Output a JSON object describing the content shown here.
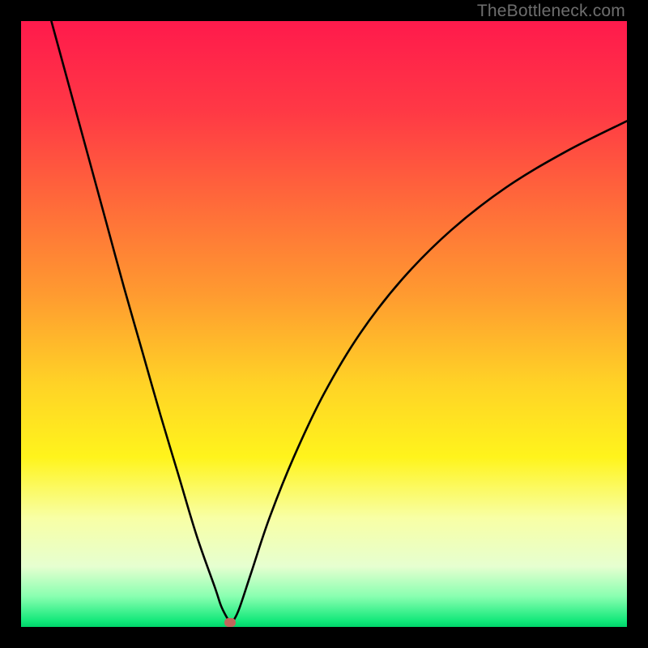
{
  "watermark": "TheBottleneck.com",
  "marker_color": "#c1665b",
  "chart_data": {
    "type": "line",
    "title": "",
    "xlabel": "",
    "ylabel": "",
    "xlim": [
      0,
      100
    ],
    "ylim": [
      0,
      100
    ],
    "grid": false,
    "background_gradient_stops": [
      {
        "pct": 0,
        "color": "#ff1a4c"
      },
      {
        "pct": 15,
        "color": "#ff3945"
      },
      {
        "pct": 30,
        "color": "#ff6a3a"
      },
      {
        "pct": 45,
        "color": "#ff9a30"
      },
      {
        "pct": 60,
        "color": "#ffd326"
      },
      {
        "pct": 72,
        "color": "#fff41c"
      },
      {
        "pct": 82,
        "color": "#f8ffa5"
      },
      {
        "pct": 90,
        "color": "#e6ffd0"
      },
      {
        "pct": 95,
        "color": "#88ffb0"
      },
      {
        "pct": 99,
        "color": "#12e87a"
      },
      {
        "pct": 100,
        "color": "#00d46a"
      }
    ],
    "series": [
      {
        "name": "bottleneck-curve",
        "color": "#000000",
        "x": [
          5,
          8,
          11,
          14,
          17,
          20,
          23,
          26,
          29,
          32,
          33,
          34,
          34.5,
          35,
          36,
          38,
          41,
          45,
          50,
          56,
          63,
          71,
          80,
          90,
          100
        ],
        "y": [
          100,
          89,
          78,
          67,
          56,
          45.5,
          35,
          25,
          15,
          6.5,
          3.5,
          1.5,
          0.8,
          1.0,
          3,
          9,
          18,
          28,
          38.5,
          48.5,
          57.5,
          65.5,
          72.5,
          78.5,
          83.5
        ]
      }
    ],
    "marker": {
      "x": 34.5,
      "y": 0.8,
      "color": "#c1665b"
    }
  }
}
